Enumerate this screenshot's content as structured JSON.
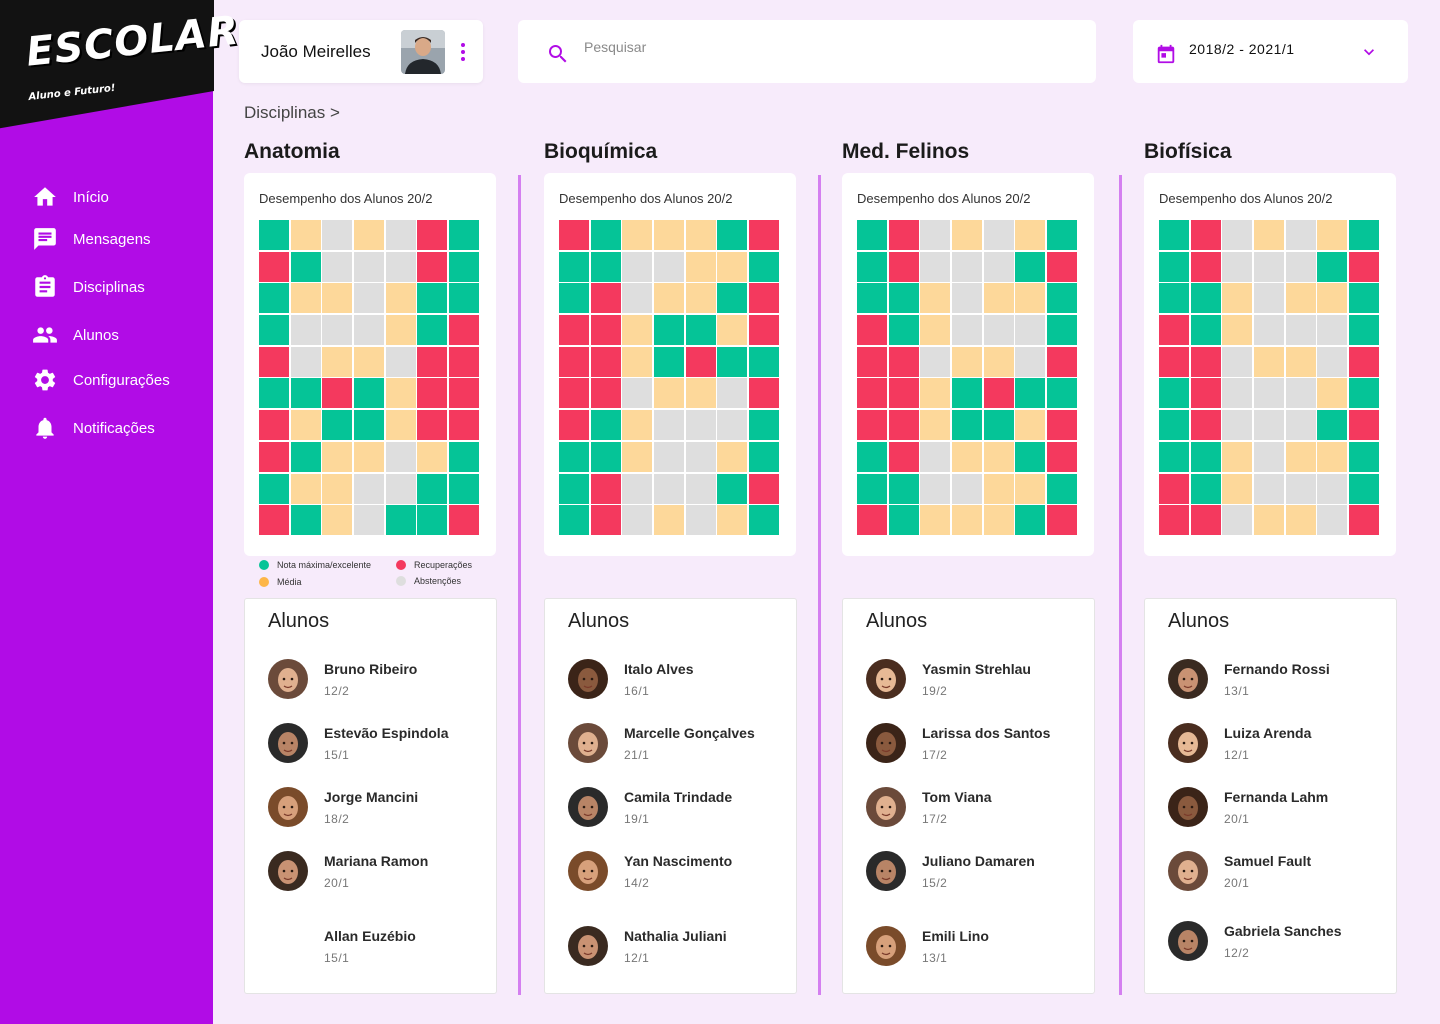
{
  "brand": {
    "name": "ESCOLAR",
    "tagline": "Aluno e Futuro!"
  },
  "colors": {
    "accent": "#b10ce6",
    "excelente": "#05c497",
    "recuperacao": "#f4395e",
    "media": "#fdd89a",
    "abstencao": "#dedede"
  },
  "sidebar": {
    "items": [
      {
        "label": "Início",
        "icon": "home-icon"
      },
      {
        "label": "Mensagens",
        "icon": "message-icon"
      },
      {
        "label": "Disciplinas",
        "icon": "clipboard-icon"
      },
      {
        "label": "Alunos",
        "icon": "people-icon"
      },
      {
        "label": "Configurações",
        "icon": "gear-icon"
      },
      {
        "label": "Notificações",
        "icon": "bell-icon"
      }
    ]
  },
  "header": {
    "user_name": "João Meirelles",
    "search_placeholder": "Pesquisar",
    "period": "2018/2 - 2021/1"
  },
  "breadcrumb": "Disciplinas >",
  "legend": {
    "excelente": "Nota máxima/excelente",
    "recuperacao": "Recuperações",
    "media": "Média",
    "abstencao": "Abstenções"
  },
  "students_title": "Alunos",
  "columns": [
    {
      "title": "Anatomia",
      "perf_title": "Desempenho dos Alunos 20/2",
      "grid": [
        "GYAYARG",
        "RGAAARG",
        "GYYAYGG",
        "GAAAYGR",
        "RAYYARR",
        "GGRGYRR",
        "RYGGYRR",
        "RGYYAYG",
        "GYYAAGG",
        "RGYAGGR"
      ],
      "students": [
        {
          "name": "Bruno Ribeiro",
          "term": "12/2",
          "avatar": true
        },
        {
          "name": "Estevão Espindola",
          "term": "15/1",
          "avatar": true
        },
        {
          "name": "Jorge Mancini",
          "term": "18/2",
          "avatar": true
        },
        {
          "name": "Mariana Ramon",
          "term": "20/1",
          "avatar": true
        },
        {
          "name": "Allan Euzébio",
          "term": "15/1",
          "avatar": false
        }
      ]
    },
    {
      "title": "Bioquímica",
      "perf_title": "Desempenho dos Alunos 20/2",
      "grid": [
        "RGYYYGR",
        "GGAAYYG",
        "GRAYYGR",
        "RRYGGYR",
        "RRYGRGG",
        "RRAYYAR",
        "RGYAAAG",
        "GGYAAYG",
        "GRAAAGR",
        "GRAYAYG"
      ],
      "students": [
        {
          "name": "Italo Alves",
          "term": "16/1",
          "avatar": true
        },
        {
          "name": "Marcelle Gonçalves",
          "term": "21/1",
          "avatar": true
        },
        {
          "name": "Camila Trindade",
          "term": "19/1",
          "avatar": true
        },
        {
          "name": "Yan Nascimento",
          "term": "14/2",
          "avatar": true
        },
        {
          "name": "Nathalia Juliani",
          "term": "12/1",
          "avatar": true
        }
      ]
    },
    {
      "title": "Med. Felinos",
      "perf_title": "Desempenho dos Alunos 20/2",
      "grid": [
        "GRAYAYG",
        "GRAAAGR",
        "GGYAYYG",
        "RGYAAAG",
        "RRAYYAR",
        "RRYGRGG",
        "RRYGGYR",
        "GRAYYGR",
        "GGAAYYG",
        "RGYYYGR"
      ],
      "students": [
        {
          "name": "Yasmin Strehlau",
          "term": "19/2",
          "avatar": true
        },
        {
          "name": "Larissa dos Santos",
          "term": "17/2",
          "avatar": true
        },
        {
          "name": "Tom Viana",
          "term": "17/2",
          "avatar": true
        },
        {
          "name": "Juliano Damaren",
          "term": "15/2",
          "avatar": true
        },
        {
          "name": "Emili Lino",
          "term": "13/1",
          "avatar": true
        }
      ]
    },
    {
      "title": "Biofísica",
      "perf_title": "Desempenho dos Alunos 20/2",
      "grid": [
        "GRAYAYG",
        "GRAAAGR",
        "GGYAYYG",
        "RGYAAAG",
        "RRAYYAR",
        "GRAAAYG",
        "GRAAAGR",
        "GGYAYYG",
        "RGYAAAG",
        "RRAYYAR"
      ],
      "students": [
        {
          "name": "Fernando Rossi",
          "term": "13/1",
          "avatar": true
        },
        {
          "name": "Luiza Arenda",
          "term": "12/1",
          "avatar": true
        },
        {
          "name": "Fernanda Lahm",
          "term": "20/1",
          "avatar": true
        },
        {
          "name": "Samuel Fault",
          "term": "20/1",
          "avatar": true
        },
        {
          "name": "Gabriela Sanches",
          "term": "12/2",
          "avatar": true
        }
      ]
    }
  ]
}
